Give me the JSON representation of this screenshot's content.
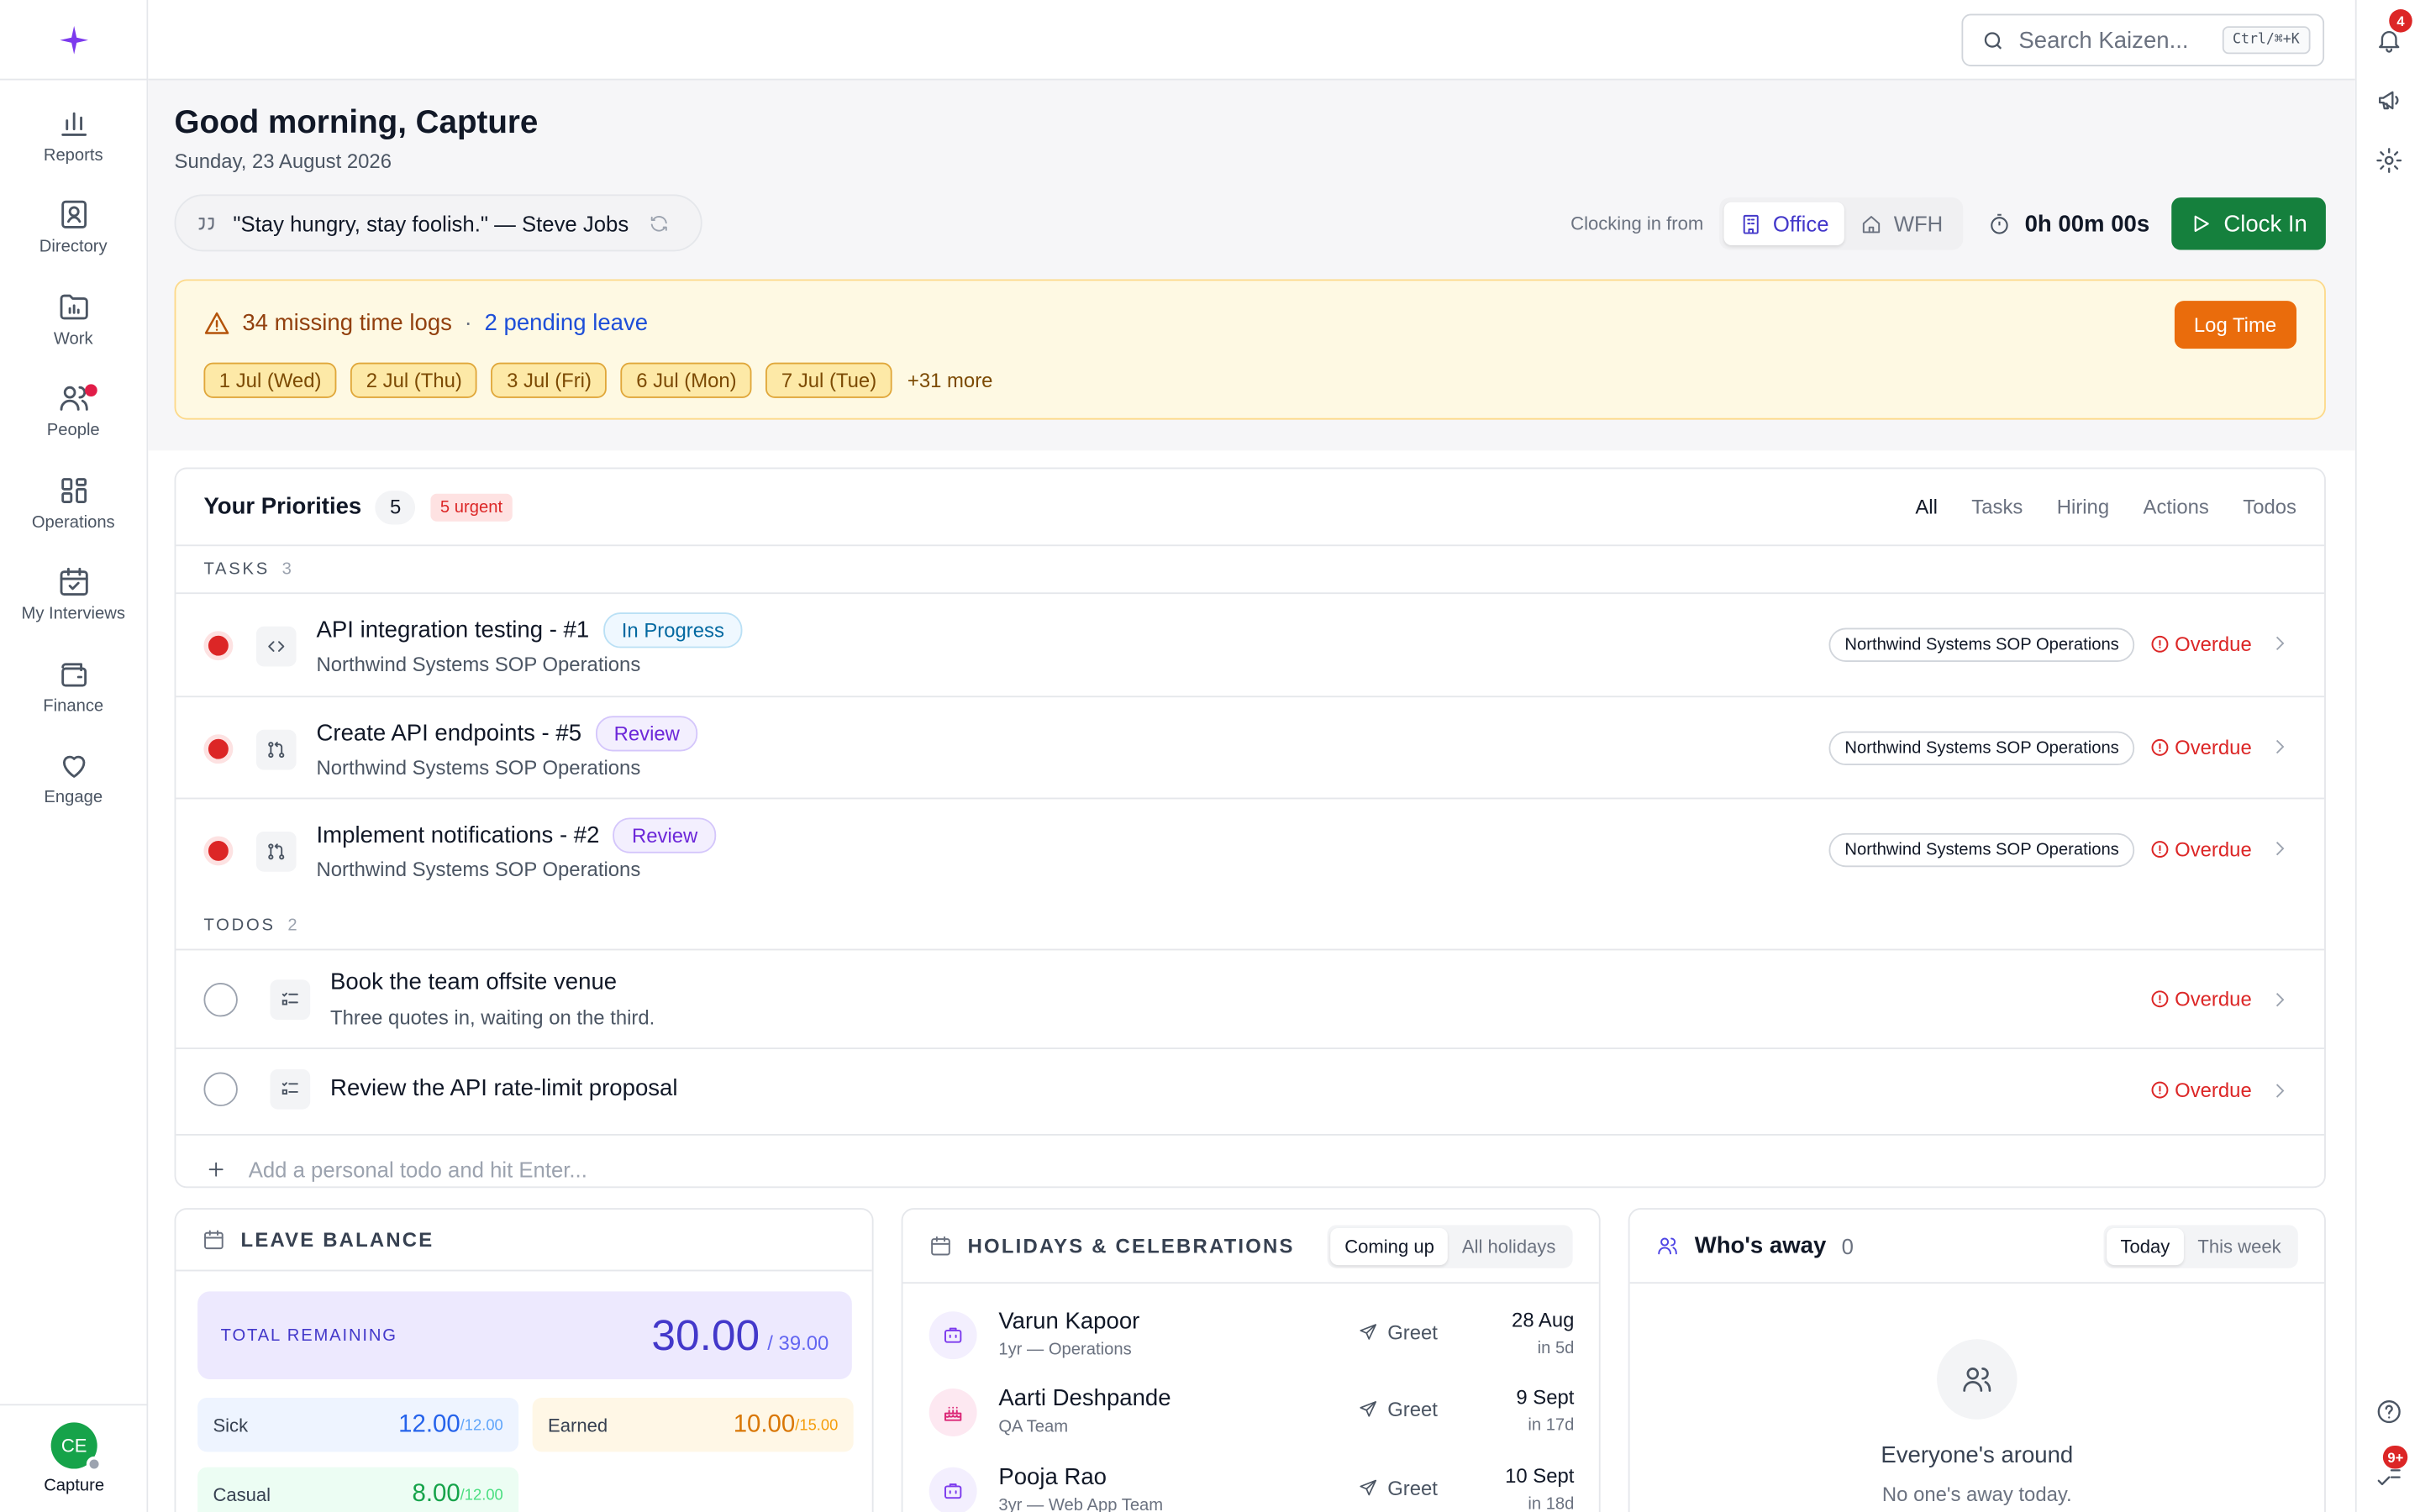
{
  "sidebar": {
    "items": [
      {
        "label": "Reports"
      },
      {
        "label": "Directory"
      },
      {
        "label": "Work"
      },
      {
        "label": "People"
      },
      {
        "label": "Operations"
      },
      {
        "label": "My Interviews"
      },
      {
        "label": "Finance"
      },
      {
        "label": "Engage"
      }
    ],
    "user": {
      "initials": "CE",
      "name": "Capture"
    }
  },
  "search": {
    "placeholder": "Search Kaizen...",
    "shortcut": "Ctrl/⌘+K"
  },
  "rail": {
    "notifications_count": "4",
    "help_badge": "9+"
  },
  "header": {
    "greeting": "Good morning, Capture",
    "date": "Sunday, 23 August 2026",
    "quote": "\"Stay hungry, stay foolish.\" — Steve Jobs"
  },
  "clock": {
    "label": "Clocking in from",
    "office": "Office",
    "wfh": "WFH",
    "timer": "0h 00m 00s",
    "button": "Clock In"
  },
  "alert": {
    "missing": "34 missing time logs",
    "separator": "·",
    "pending": "2 pending leave",
    "chips": [
      "1 Jul (Wed)",
      "2 Jul (Thu)",
      "3 Jul (Fri)",
      "6 Jul (Mon)",
      "7 Jul (Tue)"
    ],
    "more": "+31 more",
    "button": "Log Time"
  },
  "priorities": {
    "title": "Your Priorities",
    "count": "5",
    "urgent": "5 urgent",
    "filters": [
      "All",
      "Tasks",
      "Hiring",
      "Actions",
      "Todos"
    ],
    "tasks_label": "TASKS",
    "tasks_count": "3",
    "tasks": [
      {
        "title": "API integration testing - #1",
        "status": "In Progress",
        "subtitle": "Northwind Systems SOP Operations",
        "project": "Northwind Systems SOP Operations",
        "due": "Overdue"
      },
      {
        "title": "Create API endpoints - #5",
        "status": "Review",
        "subtitle": "Northwind Systems SOP Operations",
        "project": "Northwind Systems SOP Operations",
        "due": "Overdue"
      },
      {
        "title": "Implement notifications - #2",
        "status": "Review",
        "subtitle": "Northwind Systems SOP Operations",
        "project": "Northwind Systems SOP Operations",
        "due": "Overdue"
      }
    ],
    "todos_label": "TODOS",
    "todos_count": "2",
    "todos": [
      {
        "title": "Book the team offsite venue",
        "subtitle": "Three quotes in, waiting on the third.",
        "due": "Overdue"
      },
      {
        "title": "Review the API rate-limit proposal",
        "due": "Overdue"
      }
    ],
    "add_placeholder": "Add a personal todo and hit Enter..."
  },
  "leave": {
    "title": "LEAVE BALANCE",
    "total_label": "TOTAL REMAINING",
    "total": "30.00",
    "total_of": "/ 39.00",
    "types": [
      {
        "name": "Sick",
        "value": "12.00",
        "max": "/12.00",
        "color": "#2563eb",
        "bg": "#eef4ff"
      },
      {
        "name": "Earned",
        "value": "10.00",
        "max": "/15.00",
        "color": "#d97706",
        "bg": "#fff7e6"
      },
      {
        "name": "Casual",
        "value": "8.00",
        "max": "/12.00",
        "color": "#16a34a",
        "bg": "#ecfdf3"
      }
    ]
  },
  "holidays": {
    "title": "HOLIDAYS & CELEBRATIONS",
    "tabs": [
      "Coming up",
      "All holidays"
    ],
    "greet_label": "Greet",
    "items": [
      {
        "name": "Varun Kapoor",
        "meta": "1yr — Operations",
        "date": "28 Aug",
        "in": "in 5d",
        "icon": "briefcase-icon"
      },
      {
        "name": "Aarti Deshpande",
        "meta": "QA Team",
        "date": "9 Sept",
        "in": "in 17d",
        "icon": "cake-icon"
      },
      {
        "name": "Pooja Rao",
        "meta": "3yr — Web App Team",
        "date": "10 Sept",
        "in": "in 18d",
        "icon": "briefcase-icon"
      }
    ]
  },
  "away": {
    "title": "Who's away",
    "count": "0",
    "tabs": [
      "Today",
      "This week"
    ],
    "empty_title": "Everyone's around",
    "empty_sub": "No one's away today."
  },
  "colors": {
    "accent": "#4338ca",
    "clockin": "#15803d",
    "logtime": "#ea6c0c",
    "overdue": "#dc2626"
  }
}
